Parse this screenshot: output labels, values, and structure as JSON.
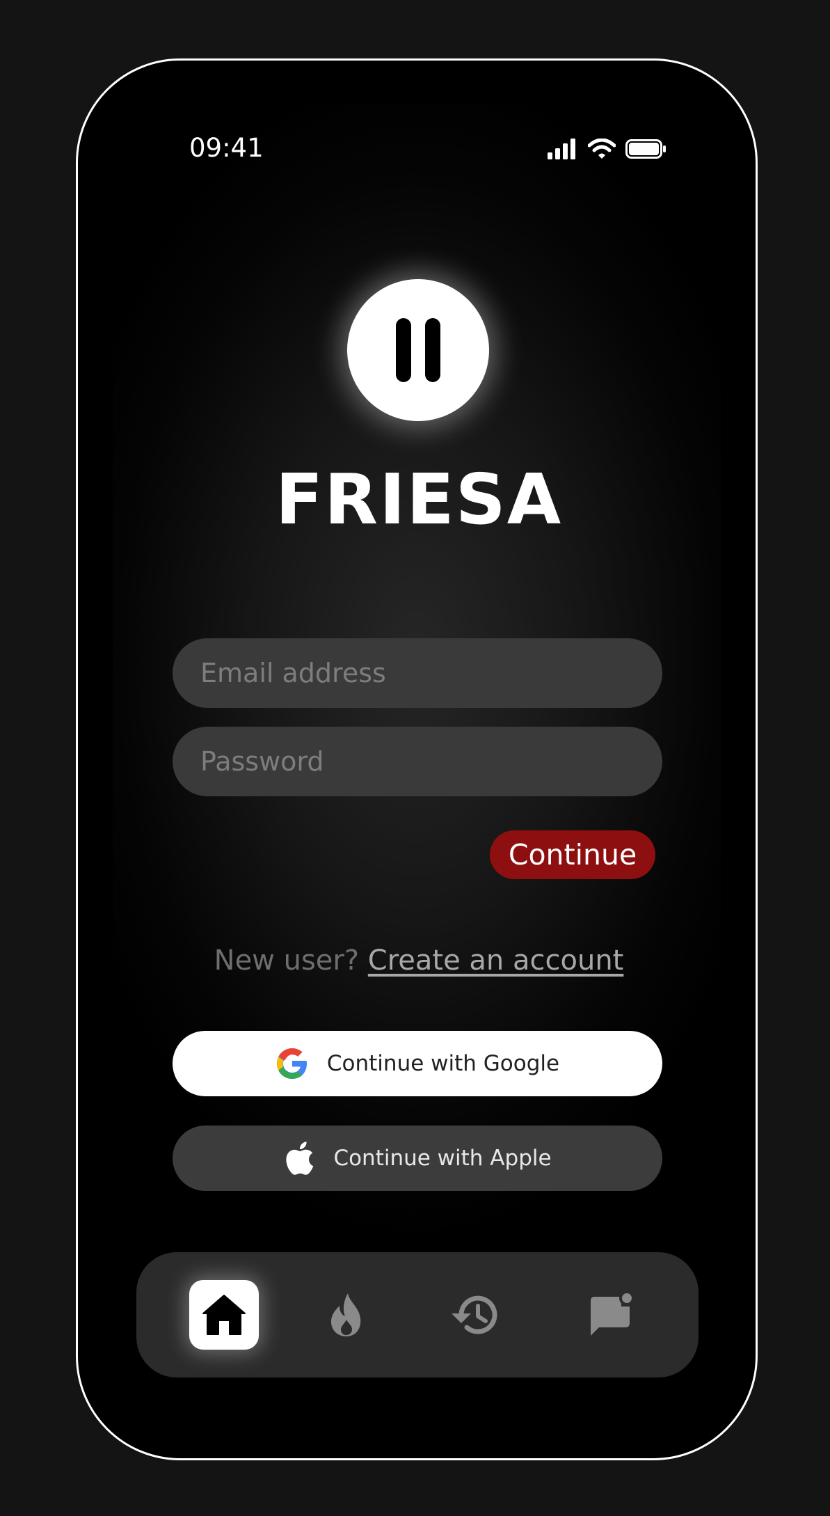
{
  "status_bar": {
    "time": "09:41",
    "icons": [
      "cellular-signal-icon",
      "wifi-icon",
      "battery-icon"
    ]
  },
  "brand": {
    "name": "FRIESA",
    "logo_icon": "pause-logo-icon"
  },
  "form": {
    "email_placeholder": "Email address",
    "email_value": "",
    "password_placeholder": "Password",
    "password_value": "",
    "continue_label": "Continue",
    "continue_color": "#8e0f0f"
  },
  "signup": {
    "prompt": "New user?",
    "link": "Create an account"
  },
  "social": {
    "google_label": "Continue with Google",
    "apple_label": "Continue with Apple"
  },
  "bottom_nav": {
    "items": [
      {
        "icon": "home-icon",
        "active": true
      },
      {
        "icon": "flame-icon",
        "active": false
      },
      {
        "icon": "history-icon",
        "active": false
      },
      {
        "icon": "chat-notification-icon",
        "active": false
      }
    ]
  }
}
